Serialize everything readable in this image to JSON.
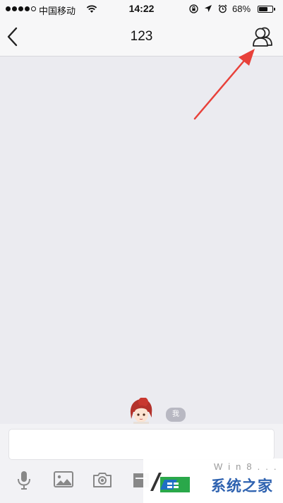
{
  "status_bar": {
    "carrier": "中国移动",
    "time": "14:22",
    "battery_percent": "68%",
    "battery_level": 0.68
  },
  "nav": {
    "title": "123"
  },
  "chat": {
    "messages": [
      {
        "text": "我"
      }
    ]
  },
  "input": {
    "value": ""
  },
  "toolbar": {
    "icons": [
      "microphone-icon",
      "image-icon",
      "camera-icon",
      "calendar-icon"
    ]
  },
  "watermark": {
    "brand": "系统之家",
    "site": "Win8..."
  },
  "colors": {
    "annotation_arrow": "#e8413a",
    "background": "#ebebf0",
    "bubble": "#b8b8c2",
    "watermark_blue": "#2e62b0"
  }
}
